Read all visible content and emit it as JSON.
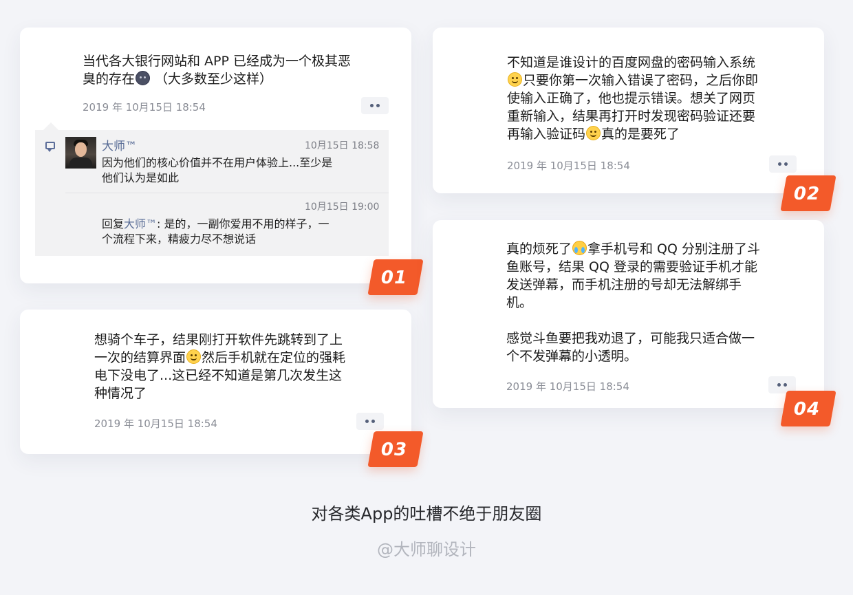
{
  "posts": [
    {
      "id": "01",
      "text_line1": "当代各大银行网站和 APP 已经成为一个极其恶",
      "text_line2_a": "臭的存在",
      "text_line2_b": " （大多数至少这样）",
      "emoji": "dark-face-emoji",
      "timestamp": "2019 年 10月15日 18:54",
      "badge": "01",
      "comments": [
        {
          "author": "大师™",
          "time": "10月15日 18:58",
          "text_line1": "因为他们的核心价值并不在用户体验上...至少是",
          "text_line2": "他们认为是如此"
        },
        {
          "time": "10月15日 19:00",
          "reply_prefix": "回复",
          "reply_to": "大师™",
          "text_line1_rest": ": 是的，一副你爱用不用的样子，一",
          "text_line2": "个流程下来，精疲力尽不想说话"
        }
      ]
    },
    {
      "id": "02",
      "lines": [
        "不知道是谁设计的百度网盘的密码输入系统",
        "只要你第一次输入错误了密码，之后你即",
        "使输入正确了，他也提示错误。想关了网页",
        "重新输入，结果再打开时发现密码验证还要",
        "再输入验证码",
        "真的是要死了"
      ],
      "timestamp": "2019 年 10月15日 18:54",
      "badge": "02"
    },
    {
      "id": "03",
      "lines": [
        "想骑个车子，结果刚打开软件先跳转到了上",
        "一次的结算界面",
        "然后手机就在定位的强耗",
        "电下没电了...这已经不知道是第几次发生这",
        "种情况了"
      ],
      "timestamp": "2019 年 10月15日 18:54",
      "badge": "03"
    },
    {
      "id": "04",
      "lines": [
        "真的烦死了",
        "拿手机号和 QQ 分别注册了斗",
        "鱼账号，结果 QQ 登录的需要验证手机才能",
        "发送弹幕，而手机注册的号却无法解绑手",
        "机。",
        "感觉斗鱼要把我劝退了，可能我只适合做一",
        "个不发弹幕的小透明。"
      ],
      "timestamp": "2019 年 10月15日 18:54",
      "badge": "04"
    }
  ],
  "caption": "对各类App的吐槽不绝于朋友圈",
  "handle": "@大师聊设计",
  "colors": {
    "background": "#f3f4f8",
    "badge": "#f35a2a",
    "link": "#576b95"
  }
}
